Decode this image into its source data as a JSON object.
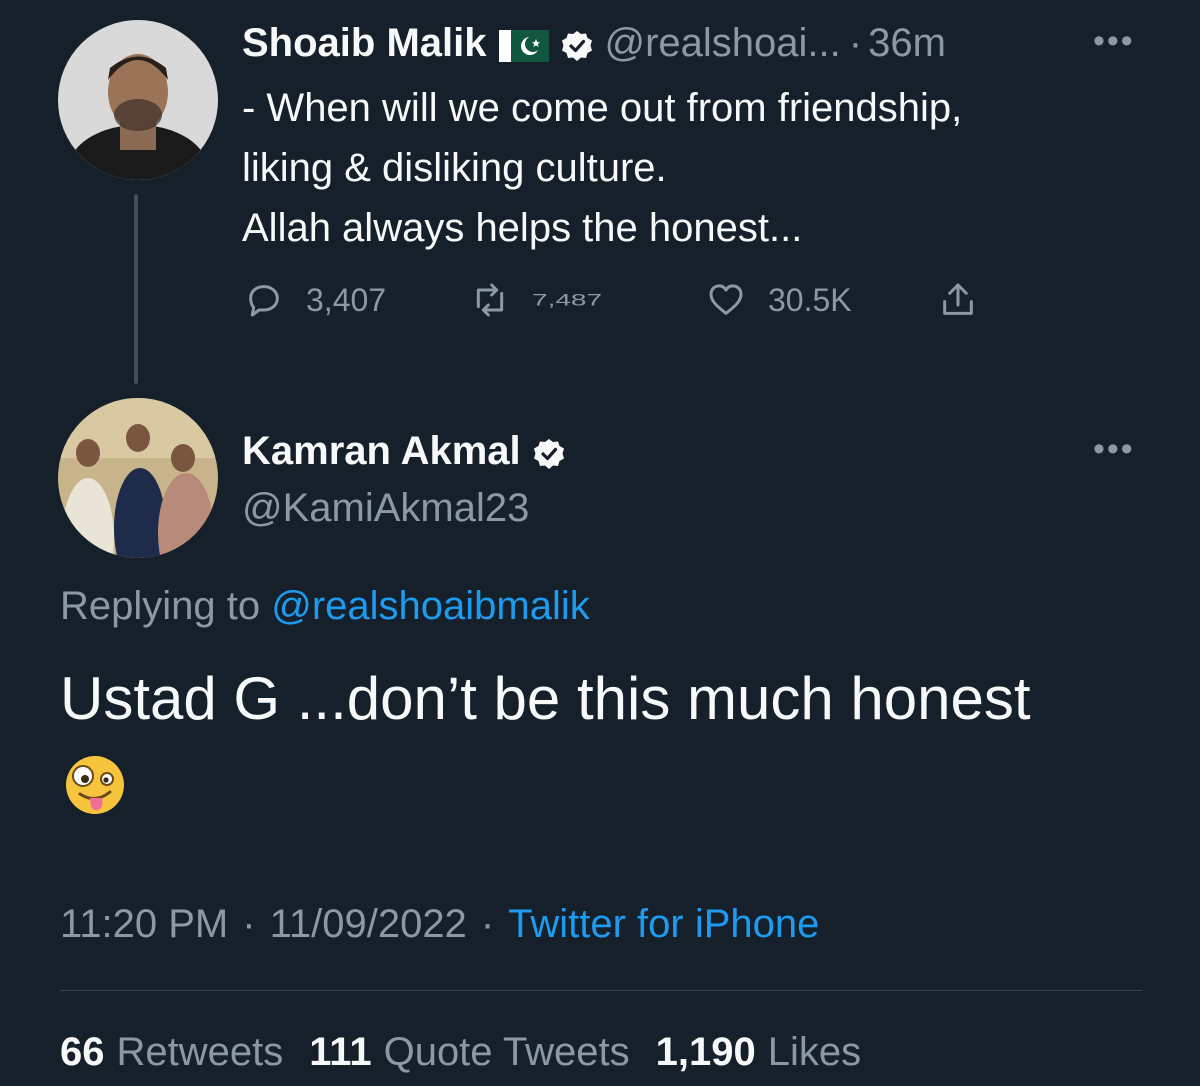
{
  "original_tweet": {
    "author_name": "Shoaib Malik",
    "flag": "🇵🇰",
    "handle": "@realshoai...",
    "separator": "·",
    "time_ago": "36m",
    "more": "•••",
    "text_lines": [
      "- When will we come out from friendship,",
      "liking & disliking culture.",
      "Allah always helps the honest..."
    ],
    "replies": "3,407",
    "retweets": "7,487",
    "likes": "30.5K"
  },
  "reply_tweet": {
    "author_name": "Kamran Akmal",
    "handle": "@KamiAkmal23",
    "more": "•••",
    "replying_prefix": "Replying to",
    "replying_handle": "@realshoaibmalik",
    "text": "Ustad G ...don’t be this much honest",
    "emoji": "🤪",
    "time": "11:20 PM",
    "dot1": "·",
    "date": "11/09/2022",
    "dot2": "·",
    "source": "Twitter for iPhone"
  },
  "stats": {
    "retweets_count": "66",
    "retweets_label": "Retweets",
    "quotes_count": "111",
    "quotes_label": "Quote Tweets",
    "likes_count": "1,190",
    "likes_label": "Likes"
  },
  "colors": {
    "background": "#15202b",
    "text": "#f7f9f9",
    "muted": "#8b98a5",
    "accent": "#1d9bf0"
  }
}
